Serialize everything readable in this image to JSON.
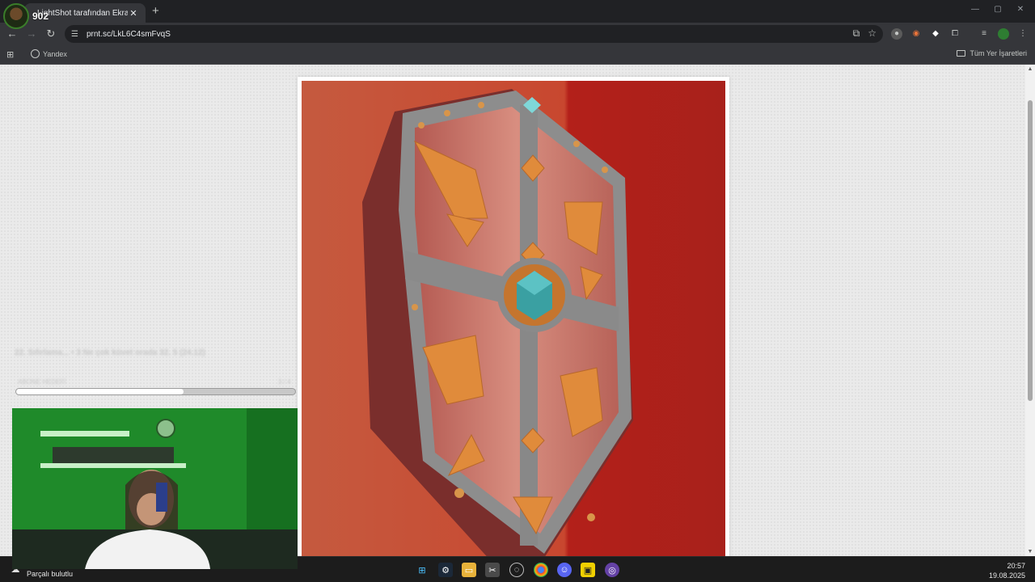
{
  "browser": {
    "tab_title": "LightShot tarafından Ekran Görüntüsü",
    "tab_close": "✕",
    "new_tab": "+",
    "window_controls": [
      "—",
      "▢",
      "✕"
    ],
    "url": "prnt.sc/LkL6C4smFvqS",
    "bookmark_yandex": "Yandex",
    "bookmark_all": "Tüm Yer İşaretleri"
  },
  "stream": {
    "viewer_count": "902",
    "overlay_title": "22. Sıfırlama... • 3 Ne çok küvet orada 32. 5 (24.12)",
    "overlay_sub": "ABONE HEDEFİ",
    "overlay_count": "3 / 4",
    "goal_progress": 0.6
  },
  "taskbar": {
    "weather": "Parçalı bulutlu",
    "time": "20:57",
    "date": "19.08.2025"
  },
  "icons": {
    "back": "back-arrow-icon",
    "forward": "forward-arrow-icon",
    "reload": "reload-icon",
    "star": "star-icon",
    "extensions": "puzzle-icon"
  },
  "colors": {
    "shield_bg": "#c8472f",
    "shield_wood": "#c16a5e",
    "shield_metal": "#8d8d8d",
    "shield_gold": "#e08b3b",
    "gem": "#3aa0a2",
    "webcam_green": "#1f8a2a"
  }
}
